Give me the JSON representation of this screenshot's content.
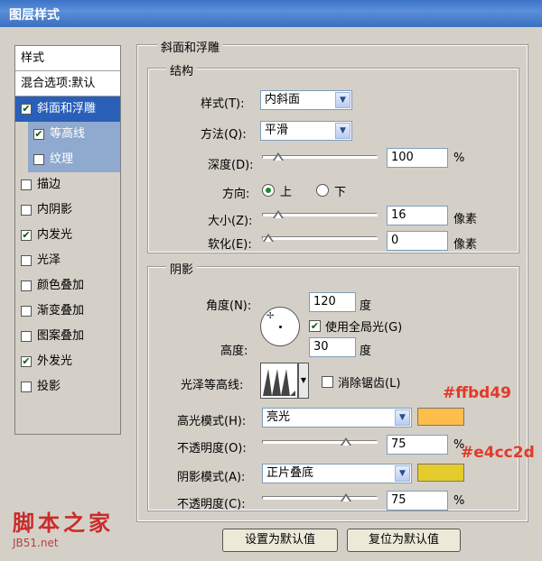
{
  "window": {
    "title": "图层样式"
  },
  "sidebar": {
    "header": "样式",
    "blend_options": "混合选项:默认",
    "items": [
      {
        "label": "斜面和浮雕",
        "checked": true
      },
      {
        "label": "等高线",
        "checked": true
      },
      {
        "label": "纹理",
        "checked": false
      },
      {
        "label": "描边",
        "checked": false
      },
      {
        "label": "内阴影",
        "checked": false
      },
      {
        "label": "内发光",
        "checked": true
      },
      {
        "label": "光泽",
        "checked": false
      },
      {
        "label": "颜色叠加",
        "checked": false
      },
      {
        "label": "渐变叠加",
        "checked": false
      },
      {
        "label": "图案叠加",
        "checked": false
      },
      {
        "label": "外发光",
        "checked": true
      },
      {
        "label": "投影",
        "checked": false
      }
    ]
  },
  "bevel": {
    "section_title": "斜面和浮雕",
    "structure": {
      "title": "结构",
      "style_label": "样式(T):",
      "style_value": "内斜面",
      "technique_label": "方法(Q):",
      "technique_value": "平滑",
      "depth_label": "深度(D):",
      "depth_value": "100",
      "depth_unit": "%",
      "depth_fraction": 0.1,
      "direction_label": "方向:",
      "direction_up": "上",
      "direction_down": "下",
      "size_label": "大小(Z):",
      "size_value": "16",
      "size_unit": "像素",
      "size_fraction": 0.1,
      "soften_label": "软化(E):",
      "soften_value": "0",
      "soften_unit": "像素",
      "soften_fraction": 0.0
    },
    "shading": {
      "title": "阴影",
      "angle_label": "角度(N):",
      "angle_value": "120",
      "angle_unit": "度",
      "global_light_label": "使用全局光(G)",
      "altitude_label": "高度:",
      "altitude_value": "30",
      "altitude_unit": "度",
      "gloss_contour_label": "光泽等高线:",
      "antialias_label": "消除锯齿(L)",
      "highlight_mode_label": "高光模式(H):",
      "highlight_mode_value": "亮光",
      "highlight_color": "#ffbd49",
      "highlight_opacity_label": "不透明度(O):",
      "highlight_opacity_value": "75",
      "highlight_opacity_unit": "%",
      "highlight_opacity_fraction": 0.75,
      "shadow_mode_label": "阴影模式(A):",
      "shadow_mode_value": "正片叠底",
      "shadow_color": "#e4cc2d",
      "shadow_opacity_label": "不透明度(C):",
      "shadow_opacity_value": "75",
      "shadow_opacity_unit": "%",
      "shadow_opacity_fraction": 0.75
    }
  },
  "annotations": {
    "highlight_hex": "#ffbd49",
    "shadow_hex": "#e4cc2d"
  },
  "buttons": {
    "make_default": "设置为默认值",
    "reset_default": "复位为默认值"
  },
  "watermark": {
    "text": "脚本之家",
    "url": "JB51.net"
  }
}
